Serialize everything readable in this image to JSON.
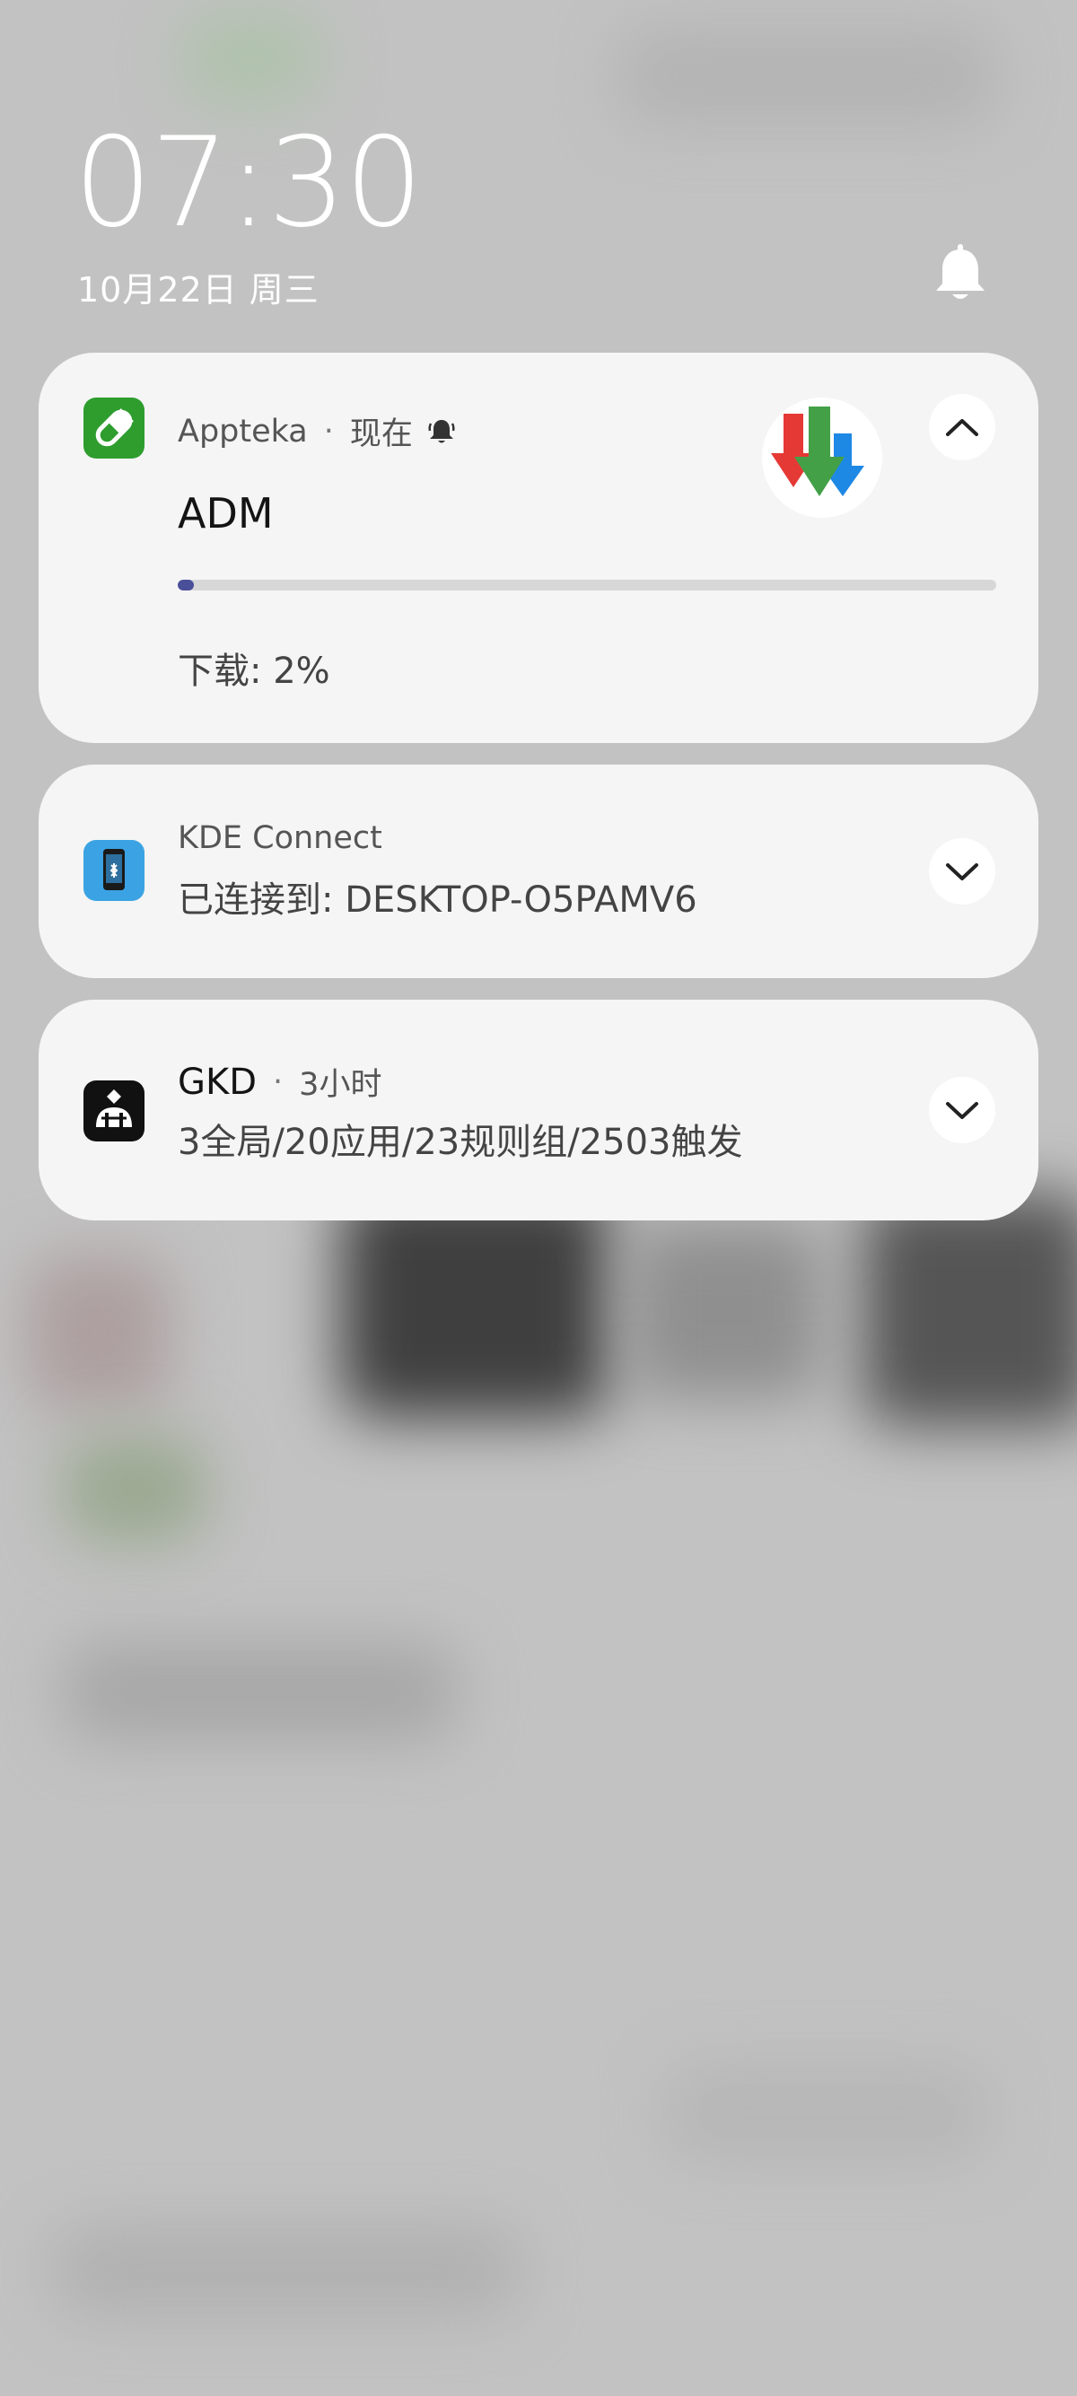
{
  "lockscreen": {
    "time": "07:30",
    "date": "10月22日 周三"
  },
  "notifications": [
    {
      "app_name": "Appteka",
      "time": "现在",
      "title": "ADM",
      "status": "下载: 2%",
      "progress": 0.02,
      "expanded": true,
      "icon": "pill-icon",
      "icon_color": "#2e9d2e"
    },
    {
      "app_name": "KDE Connect",
      "text": "已连接到: DESKTOP-O5PAMV6",
      "expanded": false,
      "icon": "phone-link-icon",
      "icon_color": "#3ba3e3"
    },
    {
      "app_name": "GKD",
      "time": "3小时",
      "text": "3全局/20应用/23规则组/2503触发",
      "expanded": false,
      "icon": "gkd-robot-icon",
      "icon_color": "#111111"
    }
  ],
  "colors": {
    "progress_fill": "#4a4f9a",
    "card_background": "#f5f5f5"
  }
}
